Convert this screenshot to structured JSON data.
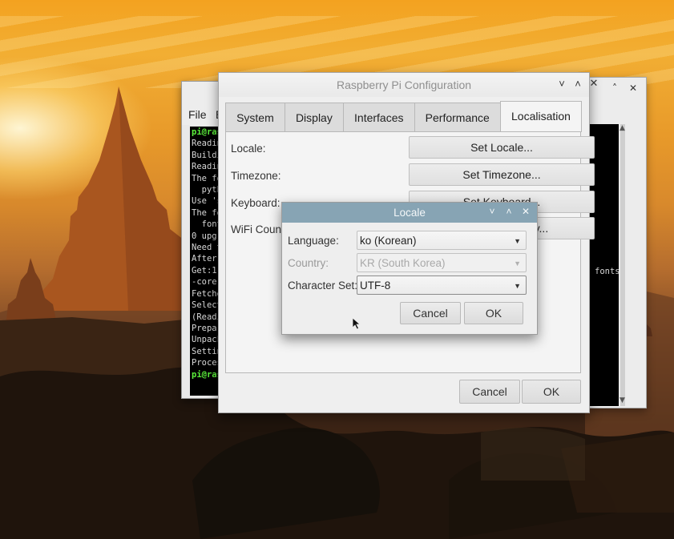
{
  "terminal": {
    "menu_file": "File",
    "menu_edit": "E",
    "lines": [
      {
        "text": "pi@rasp",
        "style": "g"
      },
      {
        "text": "Reading",
        "style": ""
      },
      {
        "text": "Buildi",
        "style": ""
      },
      {
        "text": "Reading",
        "style": ""
      },
      {
        "text": "The fo",
        "style": ""
      },
      {
        "text": "  pytho",
        "style": ""
      },
      {
        "text": "Use 'su",
        "style": ""
      },
      {
        "text": "The fo",
        "style": ""
      },
      {
        "text": "  fonts",
        "style": ""
      },
      {
        "text": "0 upgra",
        "style": ""
      },
      {
        "text": "Need to",
        "style": ""
      },
      {
        "text": "After t",
        "style": ""
      },
      {
        "text": "Get:1 h",
        "style": ""
      },
      {
        "text": "-core a",
        "style": ""
      },
      {
        "text": "Fetched",
        "style": ""
      },
      {
        "text": "Selecti",
        "style": ""
      },
      {
        "text": "(Readin",
        "style": ""
      },
      {
        "text": "Prepari",
        "style": ""
      },
      {
        "text": "Unpacki",
        "style": ""
      },
      {
        "text": "Setting",
        "style": ""
      },
      {
        "text": "Process",
        "style": ""
      },
      {
        "text": "pi@rasp",
        "style": "g"
      }
    ],
    "right_fragment": "fonts"
  },
  "ghost_window": {
    "minimize": "˄",
    "close": "✕"
  },
  "config_window": {
    "title": "Raspberry Pi Configuration",
    "controls": {
      "minimize": "˅",
      "maximize": "˄",
      "close": "✕"
    },
    "tabs": [
      {
        "label": "System",
        "active": false
      },
      {
        "label": "Display",
        "active": false
      },
      {
        "label": "Interfaces",
        "active": false
      },
      {
        "label": "Performance",
        "active": false
      },
      {
        "label": "Localisation",
        "active": true
      }
    ],
    "rows": [
      {
        "label": "Locale:",
        "button": "Set Locale..."
      },
      {
        "label": "Timezone:",
        "button": "Set Timezone..."
      },
      {
        "label": "Keyboard:",
        "button": "Set Keyboard..."
      },
      {
        "label": "WiFi Country",
        "button": "Set WiFi Country..."
      }
    ],
    "cancel_label": "Cancel",
    "ok_label": "OK"
  },
  "locale_dialog": {
    "title": "Locale",
    "controls": {
      "minimize": "˅",
      "maximize": "˄",
      "close": "✕"
    },
    "language_label": "Language:",
    "language_value": "ko (Korean)",
    "country_label": "Country:",
    "country_value": "KR (South Korea)",
    "charset_label": "Character Set:",
    "charset_value": "UTF-8",
    "cancel_label": "Cancel",
    "ok_label": "OK"
  },
  "icons": {
    "dropdown_arrow": "▼"
  },
  "colors": {
    "locale_titlebar": "#87a4b4",
    "terminal_prompt": "#5cf03c",
    "terminal_bg": "#000000"
  }
}
